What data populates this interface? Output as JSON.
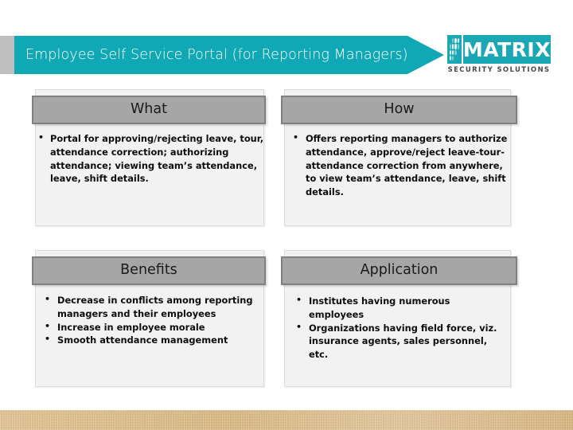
{
  "header": {
    "title": "Employee Self Service Portal (for Reporting Managers)",
    "banner_color": "#11a8b6"
  },
  "logo": {
    "name": "MATRIX",
    "tagline": "SECURITY SOLUTIONS",
    "color": "#1ba7b3"
  },
  "panels": [
    {
      "id": "what",
      "heading": "What",
      "bullets": [
        "Portal for approving/rejecting leave, tour, attendance correction; authorizing attendance; viewing team’s attendance, leave, shift details."
      ]
    },
    {
      "id": "how",
      "heading": "How",
      "bullets": [
        "Offers reporting managers to authorize attendance, approve/reject leave-tour-attendance correction from anywhere, to view team’s attendance, leave, shift details."
      ]
    },
    {
      "id": "benefits",
      "heading": "Benefits",
      "bullets": [
        "Decrease in conflicts among reporting managers and their employees",
        "Increase in employee morale",
        "Smooth attendance management"
      ]
    },
    {
      "id": "application",
      "heading": "Application",
      "bullets": [
        "Institutes having numerous employees",
        "Organizations having field force, viz. insurance agents, sales personnel, etc."
      ]
    }
  ],
  "footer": {
    "band_color": "#ddbe8b"
  }
}
